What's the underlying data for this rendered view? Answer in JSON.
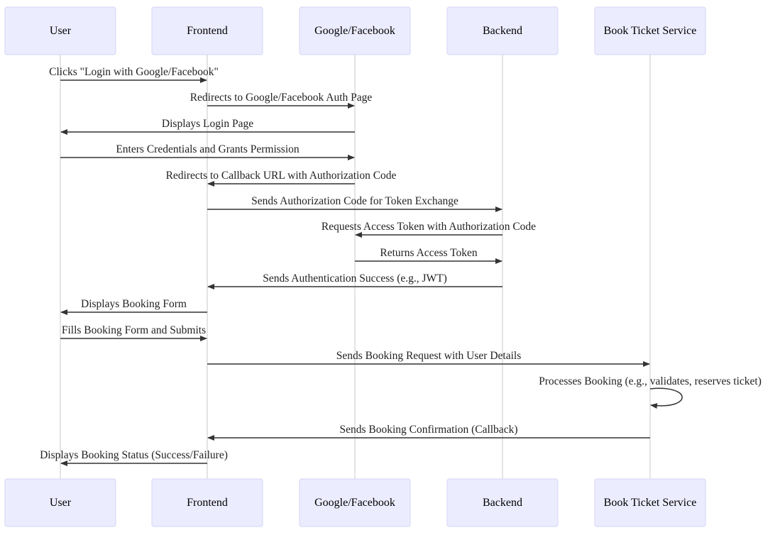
{
  "participants": [
    {
      "id": "user",
      "label": "User"
    },
    {
      "id": "frontend",
      "label": "Frontend"
    },
    {
      "id": "auth",
      "label": "Google/Facebook"
    },
    {
      "id": "backend",
      "label": "Backend"
    },
    {
      "id": "bts",
      "label": "Book Ticket Service"
    }
  ],
  "messages": [
    {
      "from": "user",
      "to": "frontend",
      "text": "Clicks \"Login with Google/Facebook\""
    },
    {
      "from": "frontend",
      "to": "auth",
      "text": "Redirects to Google/Facebook Auth Page"
    },
    {
      "from": "auth",
      "to": "user",
      "text": "Displays Login Page"
    },
    {
      "from": "user",
      "to": "auth",
      "text": "Enters Credentials and Grants Permission"
    },
    {
      "from": "auth",
      "to": "frontend",
      "text": "Redirects to Callback URL with Authorization Code"
    },
    {
      "from": "frontend",
      "to": "backend",
      "text": "Sends Authorization Code for Token Exchange"
    },
    {
      "from": "backend",
      "to": "auth",
      "text": "Requests Access Token with Authorization Code"
    },
    {
      "from": "auth",
      "to": "backend",
      "text": "Returns Access Token"
    },
    {
      "from": "backend",
      "to": "frontend",
      "text": "Sends Authentication Success (e.g., JWT)"
    },
    {
      "from": "frontend",
      "to": "user",
      "text": "Displays Booking Form"
    },
    {
      "from": "user",
      "to": "frontend",
      "text": "Fills Booking Form and Submits"
    },
    {
      "from": "frontend",
      "to": "bts",
      "text": "Sends Booking Request with User Details"
    },
    {
      "from": "bts",
      "to": "bts",
      "text": "Processes Booking (e.g., validates, reserves ticket)"
    },
    {
      "from": "bts",
      "to": "frontend",
      "text": "Sends Booking Confirmation (Callback)"
    },
    {
      "from": "frontend",
      "to": "user",
      "text": "Displays Booking Status (Success/Failure)"
    }
  ],
  "colors": {
    "actor_fill": "#ECECFF",
    "actor_stroke": "#CCCCFF",
    "line": "#333333",
    "lifeline": "#C8C8C8"
  }
}
